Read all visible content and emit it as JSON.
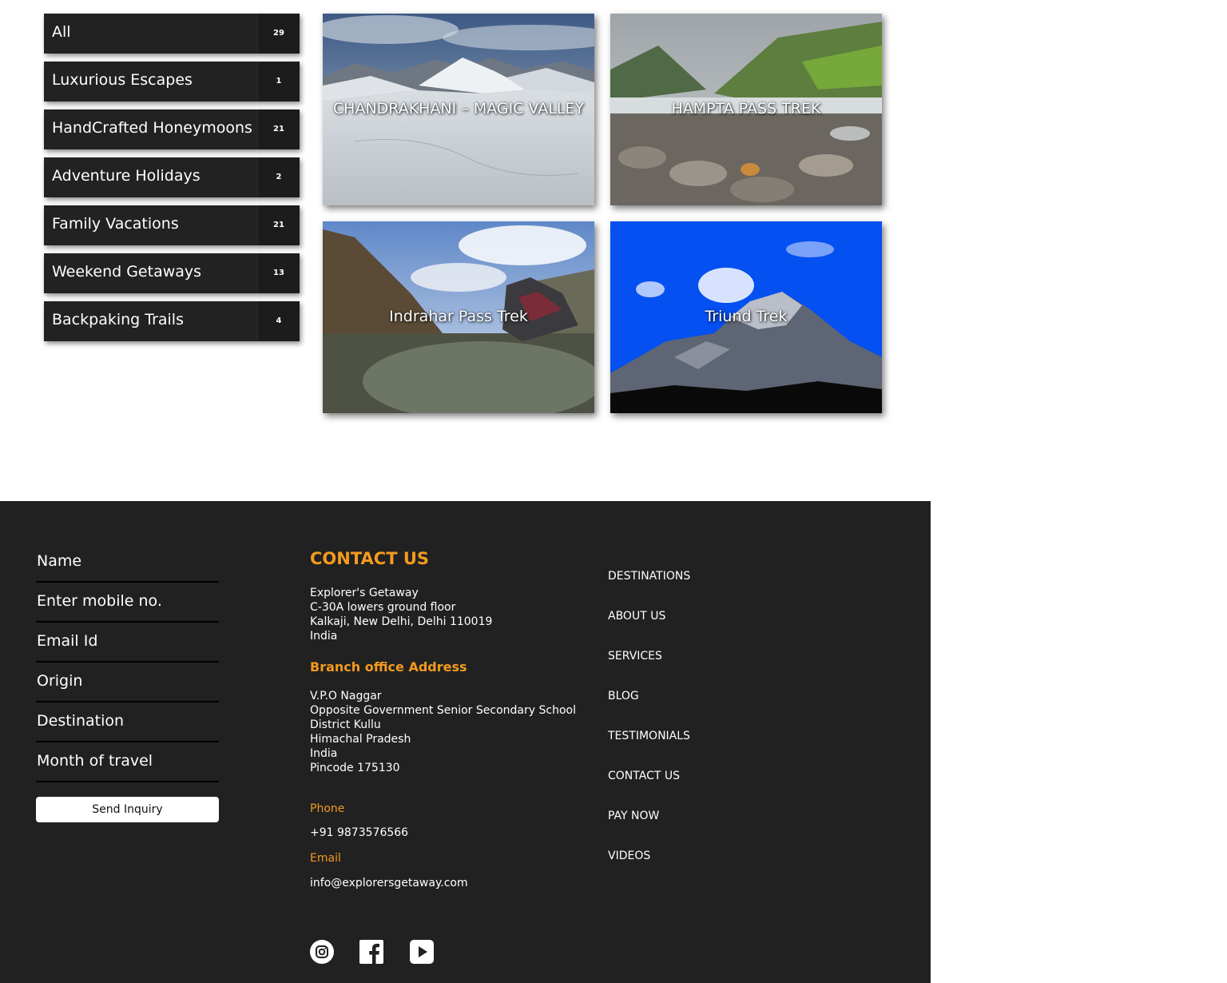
{
  "categories": [
    {
      "label": "All",
      "count": "29"
    },
    {
      "label": "Luxurious Escapes",
      "count": "1"
    },
    {
      "label": "HandCrafted Honeymoons",
      "count": "21"
    },
    {
      "label": "Adventure Holidays",
      "count": "2"
    },
    {
      "label": "Family Vacations",
      "count": "21"
    },
    {
      "label": "Weekend Getaways",
      "count": "13"
    },
    {
      "label": "Backpaking Trails",
      "count": "4"
    }
  ],
  "tours": [
    {
      "title": "CHANDRAKHANI – MAGIC VALLEY"
    },
    {
      "title": "HAMPTA PASS TREK"
    },
    {
      "title": "Indrahar Pass Trek"
    },
    {
      "title": "Triund Trek"
    }
  ],
  "form": {
    "name_placeholder": "Name",
    "mobile_placeholder": "Enter mobile no.",
    "email_placeholder": "Email Id",
    "origin_placeholder": "Origin",
    "destination_placeholder": "Destination",
    "month_placeholder": "Month of travel",
    "submit_label": "Send Inquiry"
  },
  "contact": {
    "heading": "CONTACT US",
    "address_lines": [
      "Explorer's Getaway",
      "C-30A lowers ground floor",
      "Kalkaji, New Delhi, Delhi 110019",
      "India"
    ],
    "branch_heading": "Branch office Address",
    "branch_lines": [
      "V.P.O Naggar",
      "Opposite Government Senior Secondary School",
      "District Kullu",
      "Himachal Pradesh",
      "India",
      "Pincode 175130"
    ],
    "phone_label": "Phone",
    "phone": "+91 9873576566",
    "email_label": "Email",
    "email": "info@explorersgetaway.com"
  },
  "nav": {
    "items": [
      "DESTINATIONS",
      "ABOUT US",
      "SERVICES",
      "BLOG",
      "TESTIMONIALS",
      "CONTACT US",
      "PAY NOW",
      "VIDEOS"
    ]
  },
  "social": {
    "icons": [
      "instagram-icon",
      "facebook-icon",
      "youtube-icon"
    ]
  },
  "colors": {
    "accent": "#f39a1e",
    "footer_bg": "#212121",
    "sidebar_bg": "#222222"
  }
}
